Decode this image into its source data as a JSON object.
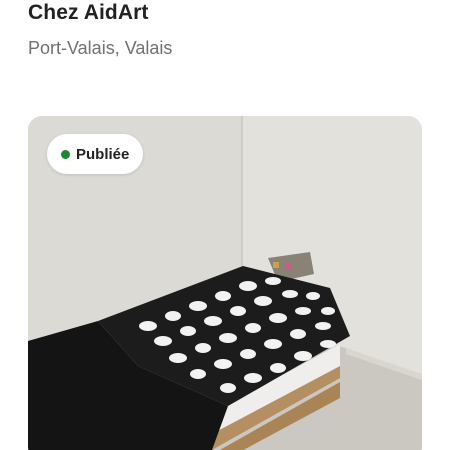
{
  "listing": {
    "title": "Chez AidArt",
    "location": "Port-Valais, Valais"
  },
  "photo": {
    "status_label": "Publiée",
    "status_color": "#1b8a2e",
    "description": "bedroom-photo"
  }
}
